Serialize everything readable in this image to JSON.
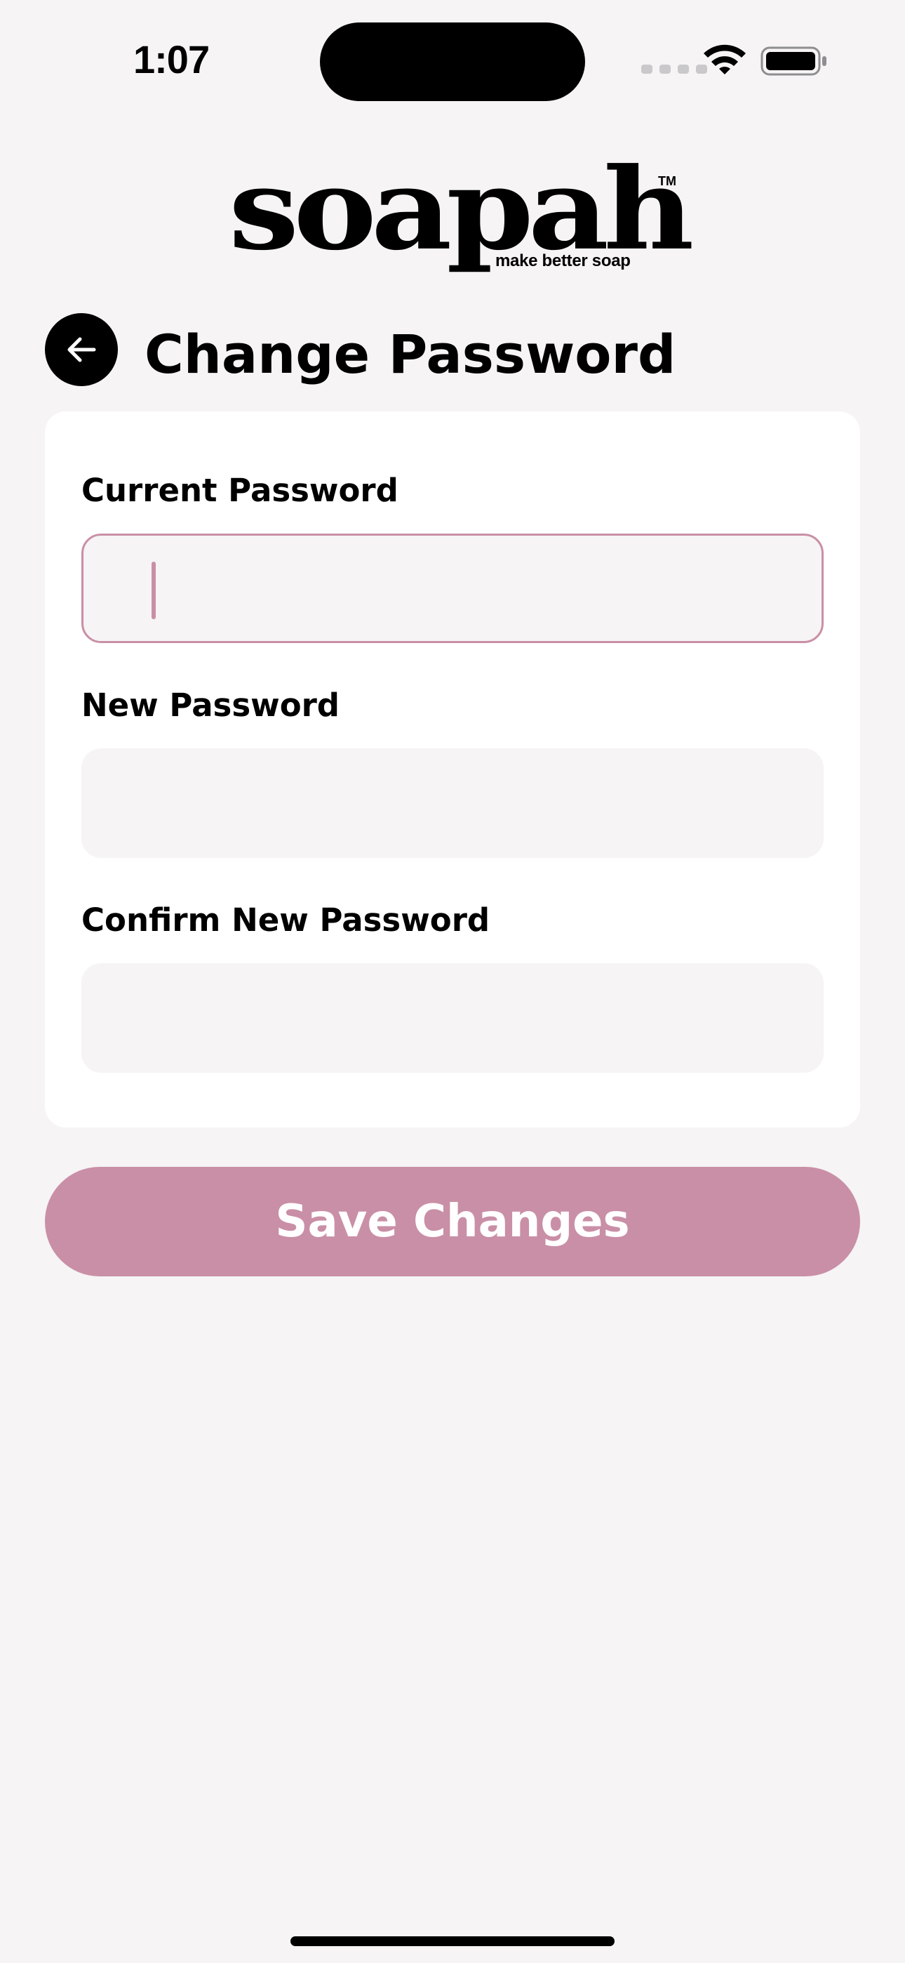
{
  "status_bar": {
    "time": "1:07",
    "icons": [
      "cell-signal-icon",
      "wifi-icon",
      "battery-icon"
    ]
  },
  "logo": {
    "wordmark": "soapah",
    "trademark": "TM",
    "tagline": "make better soap"
  },
  "header": {
    "back_icon": "arrow-left-icon",
    "title": "Change Password"
  },
  "form": {
    "fields": [
      {
        "label": "Current Password",
        "value": "",
        "placeholder": "",
        "focused": true
      },
      {
        "label": "New Password",
        "value": "",
        "placeholder": "",
        "focused": false
      },
      {
        "label": "Confirm New Password",
        "value": "",
        "placeholder": "",
        "focused": false
      }
    ]
  },
  "actions": {
    "save_label": "Save Changes"
  },
  "colors": {
    "background": "#f6f4f5",
    "card": "#ffffff",
    "accent": "#c98fa6",
    "text": "#000000"
  }
}
